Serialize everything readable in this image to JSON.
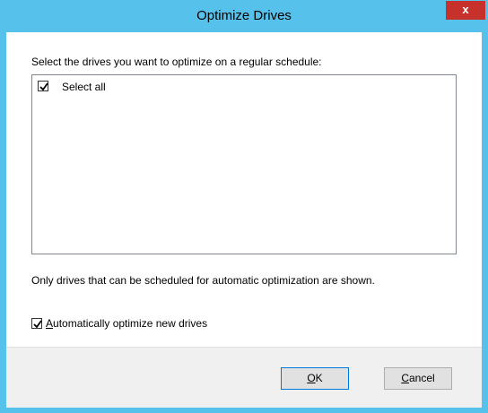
{
  "window": {
    "title": "Optimize Drives",
    "close_glyph": "x"
  },
  "dialog": {
    "instruction": "Select the drives you want to optimize on a regular schedule:",
    "list": {
      "items": [
        {
          "label": "Select all",
          "checked": true
        }
      ]
    },
    "note": "Only drives that can be scheduled for automatic optimization are shown.",
    "auto_optimize": {
      "label_accel": "A",
      "label_rest": "utomatically optimize new drives",
      "checked": true
    }
  },
  "buttons": {
    "ok": {
      "accel": "O",
      "rest": "K"
    },
    "cancel": {
      "accel": "C",
      "rest": "ancel"
    }
  },
  "colors": {
    "titlebar": "#56c2ec",
    "close_button": "#c7312b",
    "footer": "#f0f0f0",
    "default_button_border": "#0078d7"
  },
  "icons": {
    "checkmark": "check-icon",
    "close": "close-icon"
  }
}
